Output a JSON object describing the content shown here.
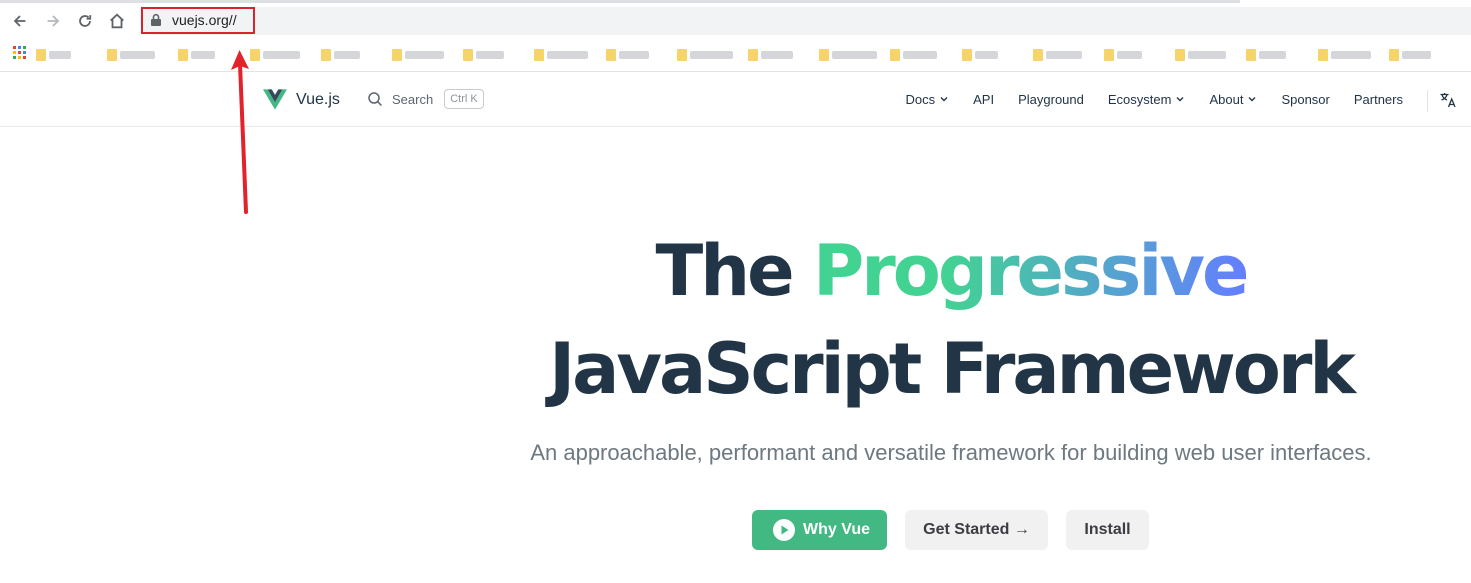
{
  "browser": {
    "url": "vuejs.org//",
    "bookmarks_count": 20
  },
  "site": {
    "brand": "Vue.js",
    "search": {
      "label": "Search",
      "shortcut": "Ctrl K"
    },
    "nav": [
      {
        "label": "Docs",
        "dropdown": true
      },
      {
        "label": "API",
        "dropdown": false
      },
      {
        "label": "Playground",
        "dropdown": false
      },
      {
        "label": "Ecosystem",
        "dropdown": true
      },
      {
        "label": "About",
        "dropdown": true
      },
      {
        "label": "Sponsor",
        "dropdown": false
      },
      {
        "label": "Partners",
        "dropdown": false
      }
    ]
  },
  "hero": {
    "title_prefix": "The",
    "title_accent": "Progressive",
    "title_line2": "JavaScript Framework",
    "tagline": "An approachable, performant and versatile framework for building web user interfaces.",
    "actions": {
      "primary": "Why Vue",
      "secondary": "Get Started →",
      "tertiary": "Install"
    }
  },
  "colors": {
    "vue_green": "#42b883",
    "text_dark": "#213547",
    "annotation_red": "#d9232d"
  },
  "icons": [
    "back-icon",
    "forward-icon",
    "reload-icon",
    "home-icon",
    "lock-icon",
    "apps-icon",
    "folder-icon",
    "vue-logo-icon",
    "search-icon",
    "chevron-down-icon",
    "translate-icon",
    "play-icon",
    "annotation-arrow-icon"
  ]
}
